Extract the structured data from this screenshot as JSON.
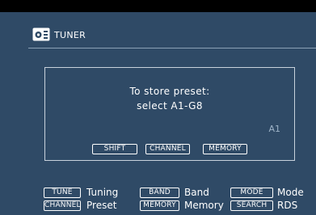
{
  "colors": {
    "screen_background": "#2f4a66",
    "text": "#ffffff",
    "dialog_border": "#c8d2dc",
    "preset_value": "#9fb4c8"
  },
  "header": {
    "icon": "radio-icon",
    "title": "TUNER"
  },
  "dialog": {
    "line1": "To store preset:",
    "line2": "select  A1-G8",
    "current_preset": "A1",
    "keys": {
      "shift": "SHIFT",
      "channel": "CHANNEL",
      "memory": "MEMORY"
    }
  },
  "footer": {
    "row1": [
      {
        "key": "TUNE",
        "label": "Tuning"
      },
      {
        "key": "BAND",
        "label": "Band"
      },
      {
        "key": "MODE",
        "label": "Mode"
      }
    ],
    "row2": [
      {
        "key": "CHANNEL",
        "label": "Preset"
      },
      {
        "key": "MEMORY",
        "label": "Memory"
      },
      {
        "key": "SEARCH",
        "label": "RDS"
      }
    ]
  }
}
